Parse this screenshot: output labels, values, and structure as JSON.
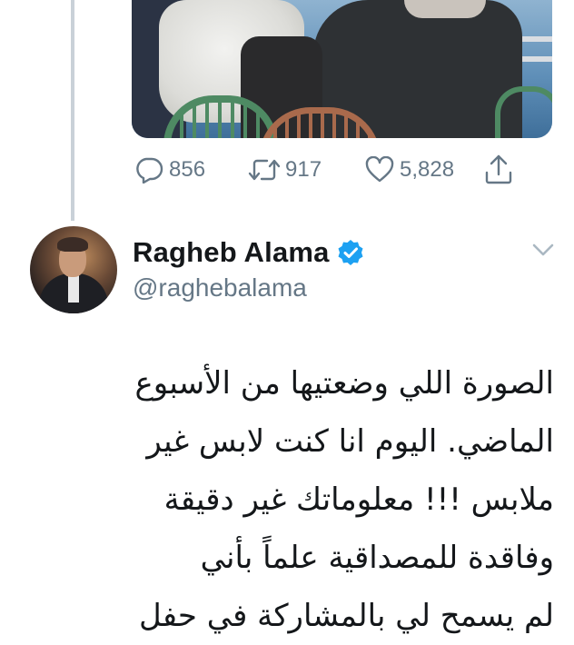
{
  "actions": {
    "reply_count": "856",
    "retweet_count": "917",
    "like_count": "5,828"
  },
  "author": {
    "name": "Ragheb Alama",
    "handle": "@raghebalama"
  },
  "tweet": {
    "lines": [
      "الصورة اللي وضعتيها من الأسبوع",
      "الماضي. اليوم انا كنت لابس غير",
      "ملابس !!! معلوماتك غير دقيقة",
      "وفاقدة للمصداقية علماً بأني",
      "لم يسمح لي بالمشاركة في حفل"
    ]
  },
  "colors": {
    "verified": "#1da1f2",
    "secondary_text": "#657786",
    "thread_line": "#c9d1d8"
  },
  "icons": [
    "reply-icon",
    "retweet-icon",
    "like-icon",
    "share-icon",
    "verified-badge-icon",
    "chevron-down-icon"
  ]
}
